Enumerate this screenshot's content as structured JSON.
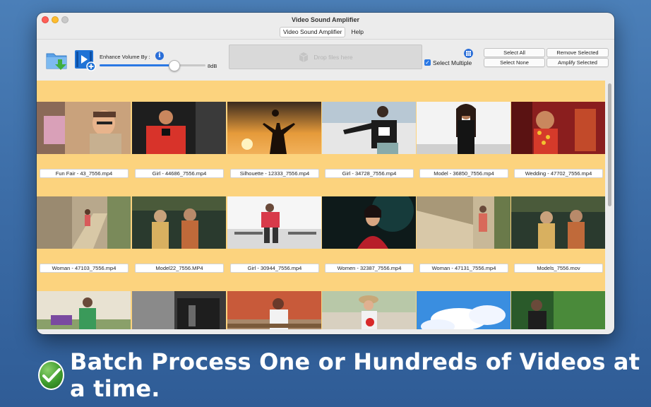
{
  "window": {
    "title": "Video Sound Amplifier",
    "tabs": [
      {
        "label": "Video Sound Amplifier",
        "active": true
      },
      {
        "label": "Help",
        "active": false
      }
    ]
  },
  "toolbar": {
    "open_folder_icon": "folder-download-icon",
    "add_video_icon": "video-add-icon",
    "enhance_label": "Enhance Volume By :",
    "info_icon": "info-icon",
    "volume_level": 0.7,
    "db_value": "8dB",
    "drop_placeholder": "Drop files here",
    "select_multiple_label": "Select Multiple",
    "select_multiple_checked": true,
    "buttons": {
      "select_all": "Select All",
      "remove_selected": "Remove Selected",
      "select_none": "Select None",
      "amplify_selected": "Amplify Selected"
    }
  },
  "videos": [
    {
      "name": "Fun Fair - 43_7556.mp4"
    },
    {
      "name": "Girl - 44686_7556.mp4"
    },
    {
      "name": "Silhouette - 12333_7556.mp4"
    },
    {
      "name": "Girl - 34728_7556.mp4"
    },
    {
      "name": "Model - 36850_7556.mp4"
    },
    {
      "name": "Wedding - 47702_7556.mp4"
    },
    {
      "name": "Woman - 47103_7556.mp4"
    },
    {
      "name": "Model22_7556.MP4"
    },
    {
      "name": "Girl - 30944_7556.mp4"
    },
    {
      "name": "Women - 32387_7556.mp4"
    },
    {
      "name": "Woman - 47131_7556.mp4"
    },
    {
      "name": "Models_7556.mov"
    }
  ],
  "tagline": "Batch Process One or Hundreds of Videos at a time.",
  "colors": {
    "background": "#3d6ea8",
    "content_area": "#fcd37e",
    "accent": "#2a78e4"
  }
}
